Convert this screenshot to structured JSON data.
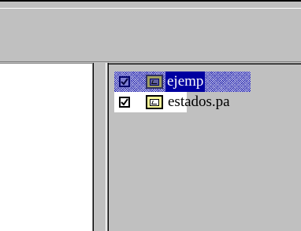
{
  "file_list": {
    "items": [
      {
        "label": "ejemp",
        "checked": true,
        "selected": true,
        "icon": "file-chart-icon"
      },
      {
        "label": "estados.pa",
        "checked": true,
        "selected": false,
        "icon": "file-chart-icon"
      }
    ]
  },
  "colors": {
    "panel": "#c0c0c0",
    "selection": "#0000a0",
    "window": "#ffffff",
    "icon_fill": "#ffff99"
  }
}
